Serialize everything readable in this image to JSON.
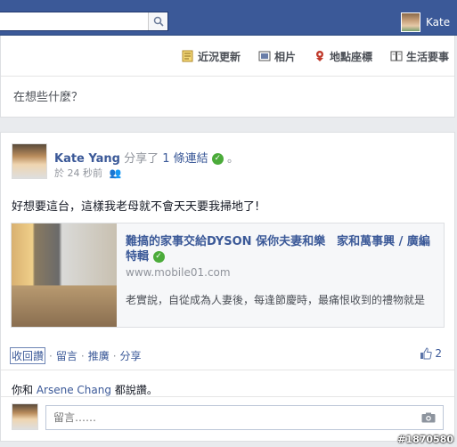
{
  "topbar": {
    "search_value": "",
    "user_name": "Kate"
  },
  "composer": {
    "tabs": [
      "近況更新",
      "相片",
      "地點座標",
      "生活要事"
    ],
    "placeholder": "在想些什麼？"
  },
  "post": {
    "author": "Kate Yang",
    "action": "分享了",
    "link_text": "1 條連結",
    "time": "於 24 秒前",
    "text": "好想要這台，這樣我老母就不會天天要我掃地了!",
    "share": {
      "title": "難搞的家事交給DYSON 保你夫妻和樂　家和萬事興 / 廣編特輯",
      "domain": "www.mobile01.com",
      "description": "老實說，自從成為人妻後，每逢節慶時，最痛恨收到的禮物就是"
    },
    "actions": [
      "收回讚",
      "留言",
      "推廣",
      "分享"
    ],
    "like_count": "2",
    "likes_line_prefix": "你和",
    "likes_line_name": "Arsene Chang",
    "likes_line_suffix": "都說讚。",
    "comment_placeholder": "留言……"
  },
  "watermark": "#1870580",
  "colors": {
    "brand": "#3b5998",
    "check": "#4bab3a"
  }
}
